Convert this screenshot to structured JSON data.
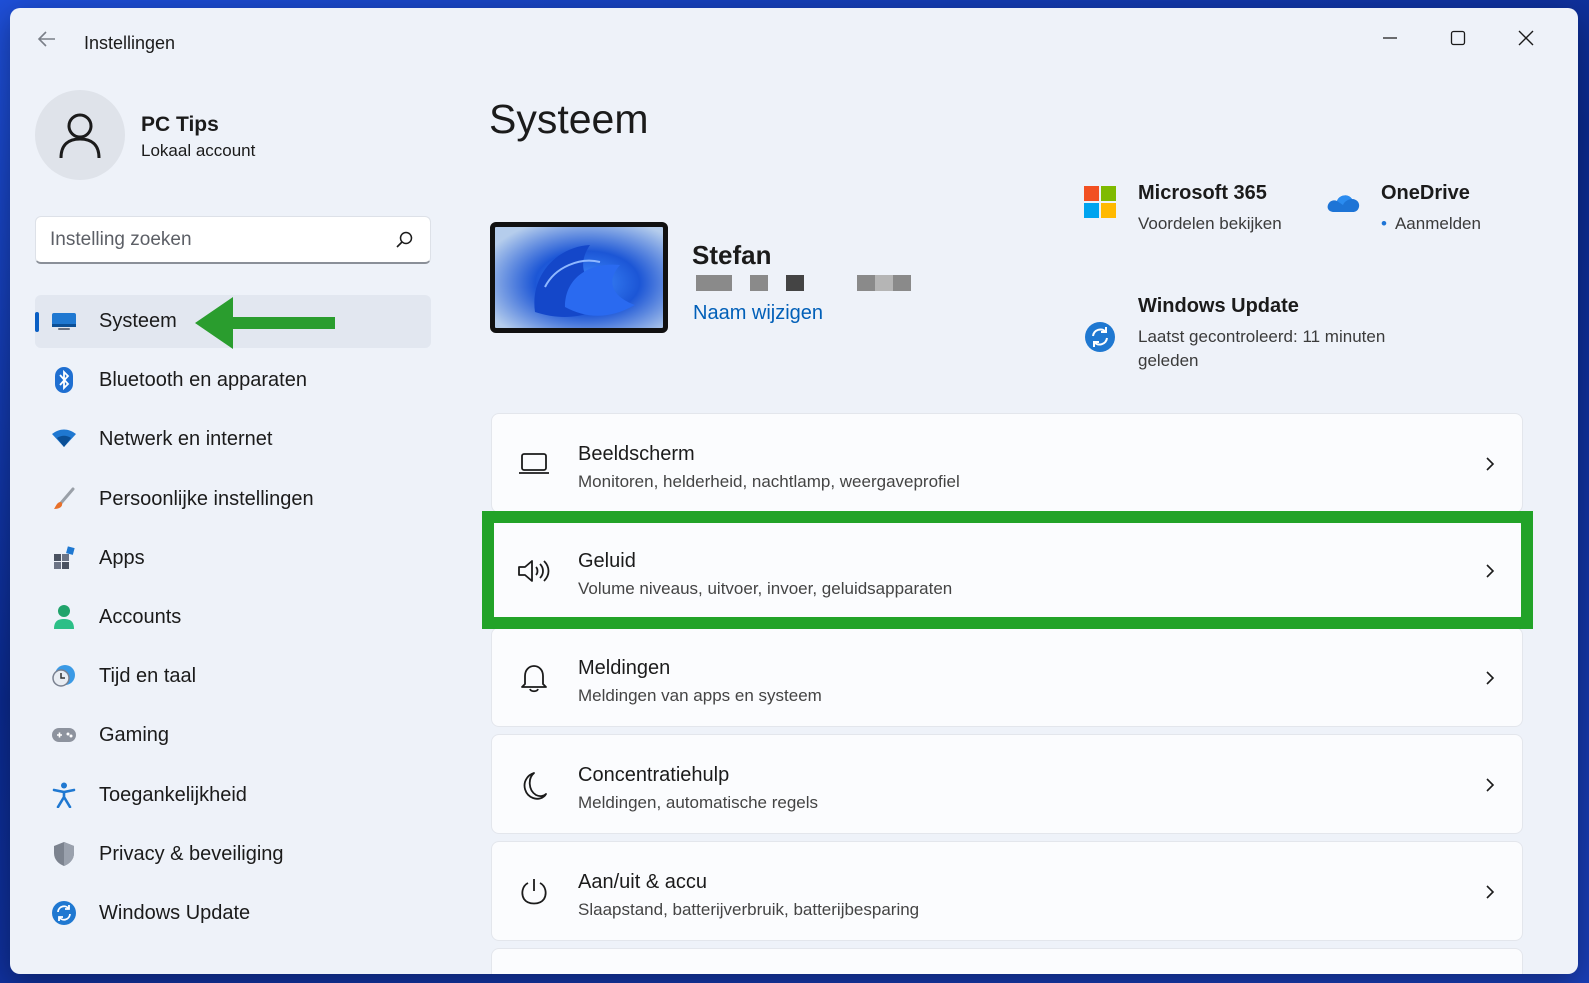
{
  "window": {
    "title": "Instellingen"
  },
  "profile": {
    "name": "PC Tips",
    "account_type": "Lokaal account"
  },
  "search": {
    "placeholder": "Instelling zoeken"
  },
  "sidebar": {
    "items": [
      {
        "label": "Systeem",
        "icon": "display-icon",
        "active": true
      },
      {
        "label": "Bluetooth en apparaten",
        "icon": "bluetooth-icon"
      },
      {
        "label": "Netwerk en internet",
        "icon": "wifi-icon"
      },
      {
        "label": "Persoonlijke instellingen",
        "icon": "brush-icon"
      },
      {
        "label": "Apps",
        "icon": "apps-icon"
      },
      {
        "label": "Accounts",
        "icon": "person-icon"
      },
      {
        "label": "Tijd en taal",
        "icon": "clock-globe-icon"
      },
      {
        "label": "Gaming",
        "icon": "gamepad-icon"
      },
      {
        "label": "Toegankelijkheid",
        "icon": "accessibility-icon"
      },
      {
        "label": "Privacy & beveiliging",
        "icon": "shield-icon"
      },
      {
        "label": "Windows Update",
        "icon": "update-icon"
      }
    ]
  },
  "main": {
    "title": "Systeem",
    "device": {
      "name": "Stefan",
      "rename_link": "Naam wijzigen"
    },
    "tiles": {
      "m365": {
        "title": "Microsoft 365",
        "subtitle": "Voordelen bekijken"
      },
      "onedrive": {
        "title": "OneDrive",
        "subtitle": "Aanmelden"
      },
      "windows_update": {
        "title": "Windows Update",
        "subtitle": "Laatst gecontroleerd: 11 minuten geleden"
      }
    },
    "cards": [
      {
        "title": "Beeldscherm",
        "subtitle": "Monitoren, helderheid, nachtlamp, weergaveprofiel",
        "icon": "monitor-icon"
      },
      {
        "title": "Geluid",
        "subtitle": "Volume niveaus, uitvoer, invoer, geluidsapparaten",
        "icon": "speaker-icon",
        "highlighted": true
      },
      {
        "title": "Meldingen",
        "subtitle": "Meldingen van apps en systeem",
        "icon": "bell-icon"
      },
      {
        "title": "Concentratiehulp",
        "subtitle": "Meldingen, automatische regels",
        "icon": "moon-icon"
      },
      {
        "title": "Aan/uit & accu",
        "subtitle": "Slaapstand, batterijverbruik, batterijbesparing",
        "icon": "power-icon"
      }
    ]
  },
  "colors": {
    "accent": "#005fb8",
    "highlight": "#22a328",
    "arrow": "#2a9d2e",
    "window_bg": "#eef2f9"
  }
}
